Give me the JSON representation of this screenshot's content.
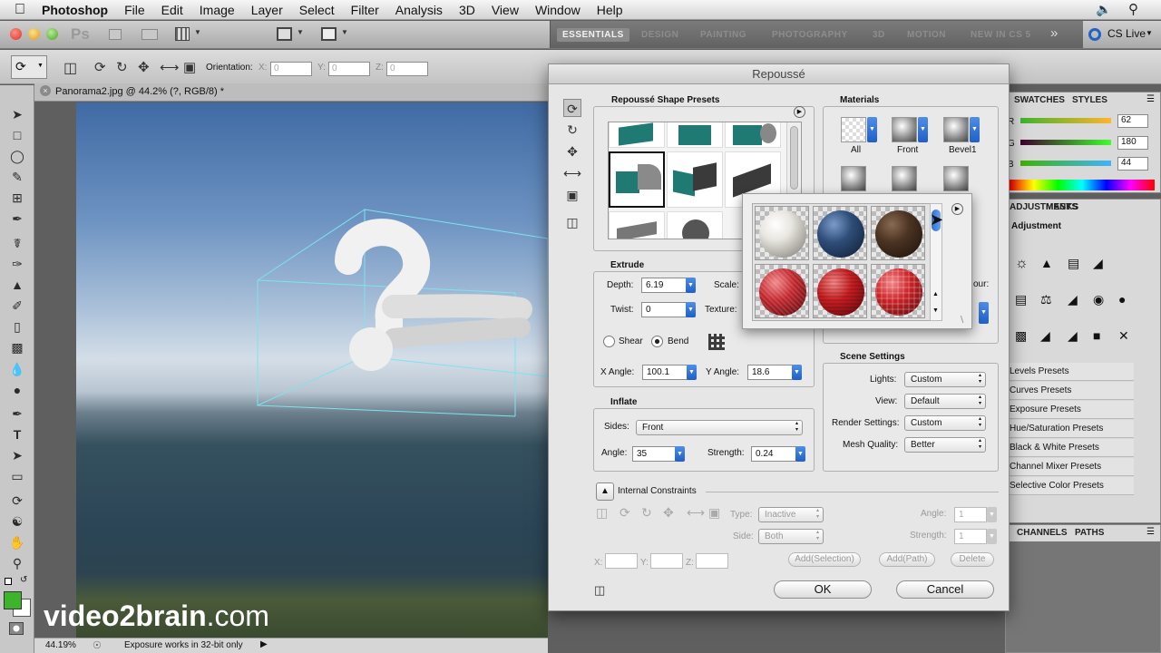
{
  "menubar": {
    "app": "Photoshop",
    "items": [
      "File",
      "Edit",
      "Image",
      "Layer",
      "Select",
      "Filter",
      "Analysis",
      "3D",
      "View",
      "Window",
      "Help"
    ]
  },
  "appbar": {
    "ps_logo": "Ps",
    "workspaces": [
      "ESSENTIALS",
      "DESIGN",
      "PAINTING",
      "PHOTOGRAPHY",
      "3D",
      "MOTION",
      "NEW IN CS 5"
    ],
    "cs_live": "CS Live"
  },
  "optionsbar": {
    "orientation_label": "Orientation:",
    "x_label": "X:",
    "x_value": "0",
    "y_label": "Y:",
    "y_value": "0",
    "z_label": "Z:",
    "z_value": "0"
  },
  "document": {
    "tab_title": "Panorama2.jpg @ 44.2% (?, RGB/8) *",
    "zoom": "44.19%",
    "status_text": "Exposure works in 32-bit only"
  },
  "watermark": {
    "brand": "video2brain",
    "suffix": ".com"
  },
  "color_panel": {
    "tabs": [
      "SWATCHES",
      "STYLES"
    ],
    "r_label": "R",
    "r_value": "62",
    "g_label": "G",
    "g_value": "180",
    "b_label": "B",
    "b_value": "44"
  },
  "adjustments_panel": {
    "tabs": [
      "ADJUSTMENTS",
      "MASKS"
    ],
    "heading": "Adjustment",
    "presets": [
      "Levels Presets",
      "Curves Presets",
      "Exposure Presets",
      "Hue/Saturation Presets",
      "Black & White Presets",
      "Channel Mixer Presets",
      "Selective Color Presets"
    ]
  },
  "layers_panel": {
    "tabs": [
      "CHANNELS",
      "PATHS"
    ]
  },
  "dialog": {
    "title": "Repoussé",
    "shape_presets_label": "Repoussé Shape Presets",
    "materials_label": "Materials",
    "material_slots": [
      "All",
      "Front",
      "Bevel1"
    ],
    "extrude": {
      "label": "Extrude",
      "depth_label": "Depth:",
      "depth_value": "6.19",
      "scale_label": "Scale:",
      "twist_label": "Twist:",
      "twist_value": "0",
      "texture_label": "Texture:",
      "shear_label": "Shear",
      "bend_label": "Bend",
      "x_angle_label": "X Angle:",
      "x_angle_value": "100.1",
      "y_angle_label": "Y Angle:",
      "y_angle_value": "18.6"
    },
    "inflate": {
      "label": "Inflate",
      "sides_label": "Sides:",
      "sides_value": "Front",
      "angle_label": "Angle:",
      "angle_value": "35",
      "strength_label": "Strength:",
      "strength_value": "0.24"
    },
    "scene": {
      "label": "Scene Settings",
      "lights_label": "Lights:",
      "lights_value": "Custom",
      "view_label": "View:",
      "view_value": "Default",
      "render_label": "Render Settings:",
      "render_value": "Custom",
      "mesh_label": "Mesh Quality:",
      "mesh_value": "Better"
    },
    "bevel_contour_fragment": "our:",
    "constraints": {
      "label": "Internal Constraints",
      "type_label": "Type:",
      "type_value": "Inactive",
      "side_label": "Side:",
      "side_value": "Both",
      "angle_label": "Angle:",
      "angle_value": "1",
      "strength_label": "Strength:",
      "strength_value": "1",
      "x_label": "X:",
      "y_label": "Y:",
      "z_label": "Z:",
      "add_selection": "Add(Selection)",
      "add_path": "Add(Path)",
      "delete": "Delete"
    },
    "ok_label": "OK",
    "cancel_label": "Cancel"
  },
  "material_picker": {
    "swatches": [
      {
        "name": "white-matte",
        "color": "#e8e6e0"
      },
      {
        "name": "blue",
        "color": "#2e4d78"
      },
      {
        "name": "brown",
        "color": "#4a3322"
      },
      {
        "name": "red-fabric-1",
        "color": "#c2262d"
      },
      {
        "name": "red-fabric-2",
        "color": "#c81e22"
      },
      {
        "name": "red-plaid",
        "color": "#cc2428"
      }
    ]
  },
  "colors": {
    "accent": "#2c6fd6",
    "foreground": "#3eb42c",
    "bounding_box": "#7fe3ee"
  }
}
